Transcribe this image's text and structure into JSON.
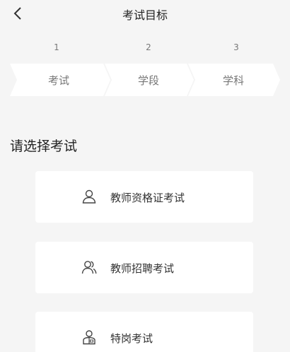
{
  "header": {
    "title": "考试目标",
    "back_icon": "chevron-left-icon"
  },
  "steps": [
    {
      "number": "1",
      "label": "考试"
    },
    {
      "number": "2",
      "label": "学段"
    },
    {
      "number": "3",
      "label": "学科"
    }
  ],
  "section": {
    "title": "请选择考试"
  },
  "options": [
    {
      "label": "教师资格证考试",
      "icon": "user-icon"
    },
    {
      "label": "教师招聘考试",
      "icon": "users-icon"
    },
    {
      "label": "特岗考试",
      "icon": "badge-user-icon"
    }
  ],
  "colors": {
    "background": "#f5f5f5",
    "card": "#ffffff",
    "step_fill": "#ffffff",
    "text_primary": "#222222",
    "text_secondary": "#777777"
  }
}
